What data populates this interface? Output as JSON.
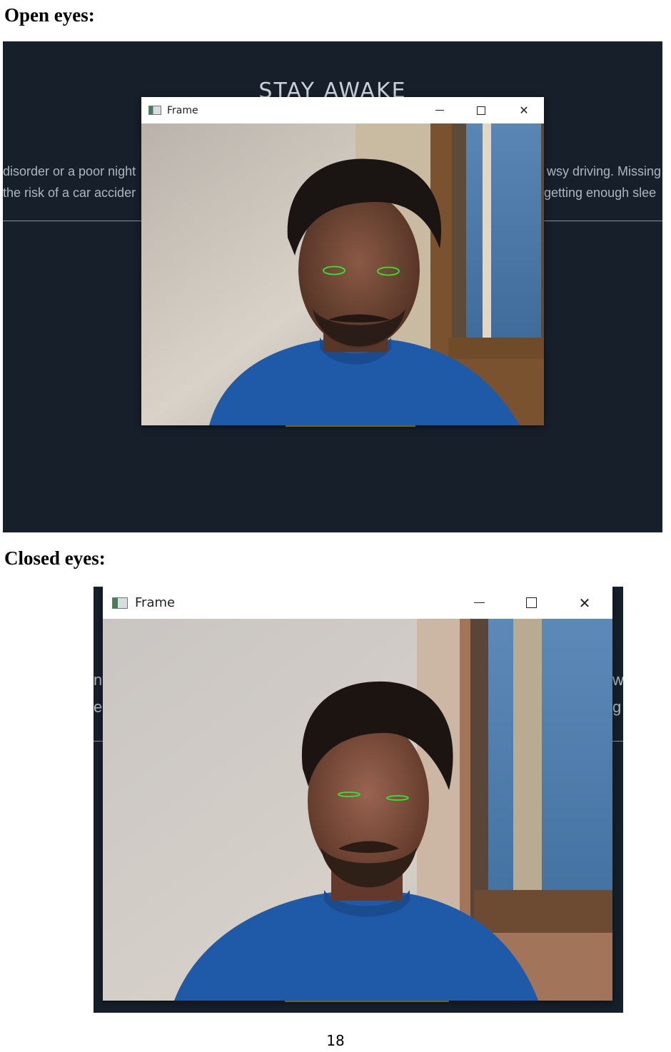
{
  "open_section": {
    "heading": "Open eyes:",
    "background": {
      "title": "STAY AWAKE",
      "left_lines": [
        "disorder or a poor night",
        "the risk of a car accider"
      ],
      "right_lines": [
        "wsy driving. Missing",
        "getting enough slee"
      ]
    },
    "window": {
      "title": "Frame",
      "minimize_glyph": "—",
      "close_glyph": "✕"
    }
  },
  "closed_section": {
    "heading": "Closed eyes:",
    "background": {
      "left_lines": [
        "nt",
        "er"
      ],
      "right_lines": [
        "w",
        "g"
      ]
    },
    "window": {
      "title": "Frame",
      "minimize_glyph": "—",
      "close_glyph": "✕"
    }
  },
  "page_number": "18",
  "colors": {
    "panel_background": "#161f2a",
    "eye_contour": "#2ee82e",
    "shirt": "#1f5aa8"
  },
  "icons": [
    "frame-app-icon",
    "minimize-icon",
    "maximize-icon",
    "close-icon"
  ]
}
